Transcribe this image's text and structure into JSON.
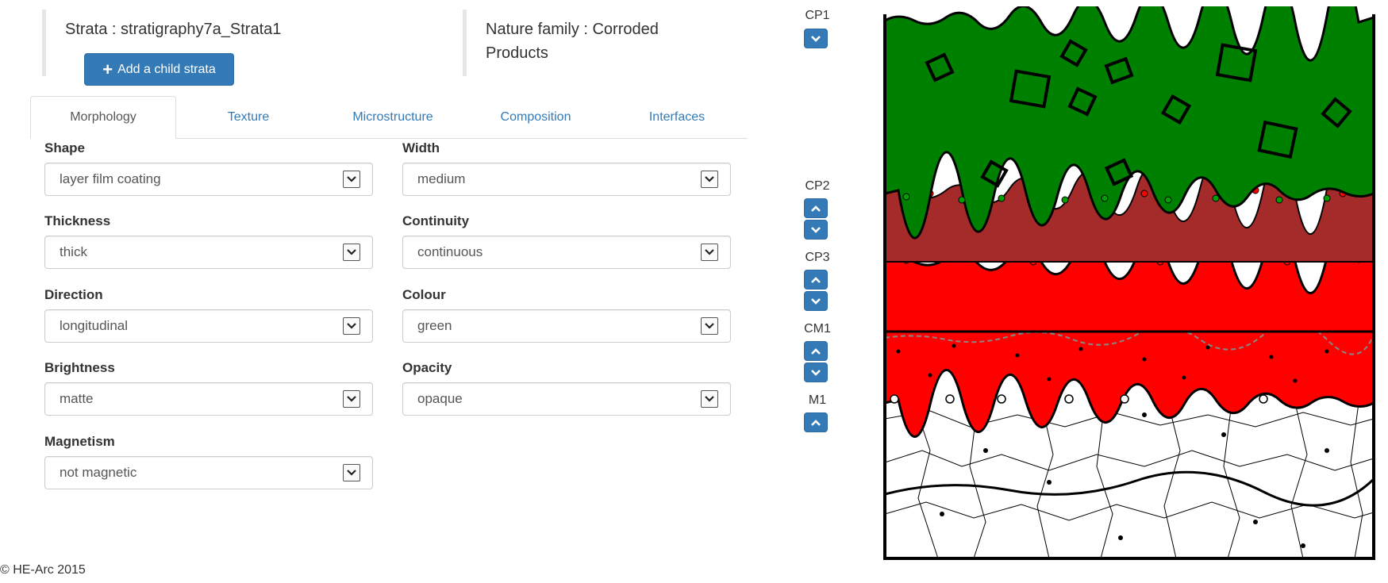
{
  "header": {
    "strata_label": "Strata : stratigraphy7a_Strata1",
    "add_child_label": "Add a child strata",
    "nature_line1": "Nature family : Corroded",
    "nature_line2": "Products"
  },
  "tabs": [
    {
      "label": "Morphology",
      "active": true
    },
    {
      "label": "Texture",
      "active": false
    },
    {
      "label": "Microstructure",
      "active": false
    },
    {
      "label": "Composition",
      "active": false
    },
    {
      "label": "Interfaces",
      "active": false
    }
  ],
  "fields": {
    "shape": {
      "label": "Shape",
      "value": "layer film coating"
    },
    "width": {
      "label": "Width",
      "value": "medium"
    },
    "thickness": {
      "label": "Thickness",
      "value": "thick"
    },
    "continuity": {
      "label": "Continuity",
      "value": "continuous"
    },
    "direction": {
      "label": "Direction",
      "value": "longitudinal"
    },
    "colour": {
      "label": "Colour",
      "value": "green"
    },
    "brightness": {
      "label": "Brightness",
      "value": "matte"
    },
    "opacity": {
      "label": "Opacity",
      "value": "opaque"
    },
    "magnetism": {
      "label": "Magnetism",
      "value": "not magnetic"
    }
  },
  "layers": [
    {
      "name": "CP1",
      "color": "#008000",
      "buttons": [
        "down"
      ]
    },
    {
      "name": "CP2",
      "color": "#a52a2a",
      "buttons": [
        "up",
        "down"
      ]
    },
    {
      "name": "CP3",
      "color": "#ff0000",
      "buttons": [
        "up",
        "down"
      ]
    },
    {
      "name": "CM1",
      "color": "#ff0000",
      "buttons": [
        "up",
        "down"
      ]
    },
    {
      "name": "M1",
      "color": "#ffffff",
      "buttons": [
        "up"
      ]
    }
  ],
  "footer": "© HE-Arc 2015",
  "icons": {
    "plus": "plus-icon",
    "up": "chevron-up-icon",
    "down": "chevron-down-icon",
    "select": "select-arrow-icon"
  },
  "colors": {
    "primary": "#337ab7",
    "link": "#337ab7"
  }
}
